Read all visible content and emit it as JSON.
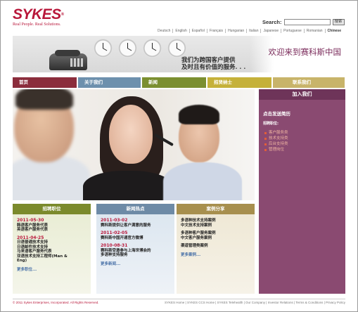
{
  "brand": {
    "name": "SYKES",
    "tagline": "Real People. Real Solutions."
  },
  "search": {
    "label": "Search:",
    "button": "搜索",
    "placeholder": ""
  },
  "languages": [
    "Deutsch",
    "English",
    "Español",
    "Français",
    "Hungarian",
    "Italian",
    "Japanese",
    "Portuguese",
    "Romanian",
    "Chinese"
  ],
  "banner": {
    "tagline_line1": "我们为跨国客户提供",
    "tagline_line2": "及时且有价值的服务. . .",
    "welcome": "欢迎来到赛科斯中国"
  },
  "nav": [
    "首页",
    "关于我们",
    "新闻",
    "招贤纳士",
    "联系我们"
  ],
  "side": {
    "title": "加入我们",
    "post_resume": "点击发送简历",
    "positions_label": "招聘职位:",
    "positions": [
      "客户服务类",
      "技术支持类",
      "后台支持类",
      "管理岗位"
    ]
  },
  "box_jobs": {
    "title": "招聘职位",
    "groups": [
      {
        "date": "2011-05-30",
        "lines": [
          "韩语客户服务代表",
          "英语客户服务代表"
        ]
      },
      {
        "date": "2011-04-25",
        "lines": [
          "日语普通技术支持",
          "日语邮件技术支持",
          "马来语客户服务代表",
          "双语技术支持工程师(Man &",
          "Eng)"
        ]
      }
    ],
    "more": "更多职位..."
  },
  "box_news": {
    "title": "新闻热点",
    "groups": [
      {
        "date": "2011-03-02",
        "lines": [
          "赛科斯提供让客户满意的服务"
        ]
      },
      {
        "date": "2011-02-05",
        "lines": [
          "赛科斯中国开通官方微博"
        ]
      },
      {
        "date": "2010-08-31",
        "lines": [
          "赛科斯受邀参与上海世博会的",
          "多语种支持服务"
        ]
      }
    ],
    "more": "更多新闻..."
  },
  "box_cases": {
    "title": "案例分享",
    "groups": [
      {
        "lines": [
          "多语种技术支持案例",
          "中文技术支持案例"
        ]
      },
      {
        "lines": [
          "多语种客户服务案例",
          "中文客户服务案例"
        ]
      },
      {
        "lines": [
          "渠道管理类案例"
        ]
      }
    ],
    "more": "更多案例..."
  },
  "footer": {
    "copyright": "© 2011 Sykes Enterprises, Incorporated. All Rights Reserved.",
    "links": "SYKES Home | SYKES CCS Home | SYKES Telehealth | Our Company | Investor Relations | Terms & Conditions | Privacy Policy"
  },
  "colors": {
    "brand_red": "#b8173a",
    "nav_home": "#8b2d3c",
    "nav_about": "#6d90ad",
    "nav_news": "#7b8f30",
    "nav_careers": "#c5b13a",
    "nav_contact": "#c8b46a",
    "side_purple": "#8a4a71"
  }
}
